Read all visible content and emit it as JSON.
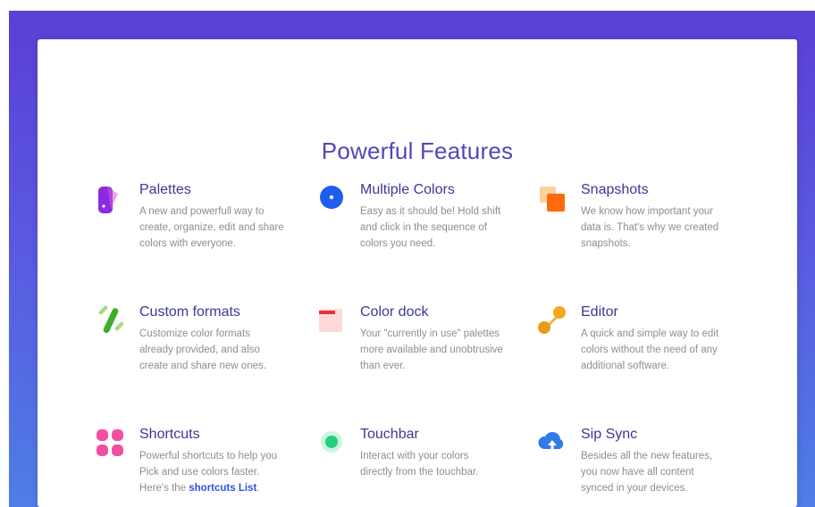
{
  "page": {
    "title": "Powerful Features"
  },
  "colors": {
    "title": "#5147b8",
    "heading": "#3b3899",
    "body": "#8d8d96",
    "link": "#2f52e8",
    "gradient_top": "#5b3fd4",
    "gradient_bottom": "#4e7ee6"
  },
  "features": [
    {
      "icon": "palettes-icon",
      "title": "Palettes",
      "lines": [
        "A new and powerfull way to",
        "create, organize, edit and share",
        "colors with everyone."
      ]
    },
    {
      "icon": "multiple-colors-icon",
      "title": "Multiple Colors",
      "lines": [
        "Easy as it should be! Hold shift",
        "and click in the sequence of",
        "colors you need."
      ]
    },
    {
      "icon": "snapshots-icon",
      "title": "Snapshots",
      "lines": [
        "We know how important your",
        "data is. That's why we created",
        "snapshots."
      ]
    },
    {
      "icon": "custom-formats-icon",
      "title": "Custom formats",
      "lines": [
        "Customize color formats",
        "already provided, and also",
        "create and share new ones."
      ]
    },
    {
      "icon": "color-dock-icon",
      "title": "Color dock",
      "lines": [
        "Your \"currently in use\" palettes",
        "more available and unobtrusive",
        "than ever."
      ]
    },
    {
      "icon": "editor-icon",
      "title": "Editor",
      "lines": [
        "A quick and simple way to edit",
        "colors without the need of any",
        "additional software."
      ]
    },
    {
      "icon": "shortcuts-icon",
      "title": "Shortcuts",
      "lines": [
        "Powerful shortcuts to help you",
        "Pick and use colors faster.",
        "Here's the "
      ],
      "link": "shortcuts List",
      "after_link": "."
    },
    {
      "icon": "touchbar-icon",
      "title": "Touchbar",
      "lines": [
        "Interact with your colors",
        "directly from the touchbar."
      ]
    },
    {
      "icon": "sip-sync-icon",
      "title": "Sip Sync",
      "lines": [
        "Besides all the new features,",
        "you now have all content",
        "synced in your devices."
      ]
    }
  ]
}
